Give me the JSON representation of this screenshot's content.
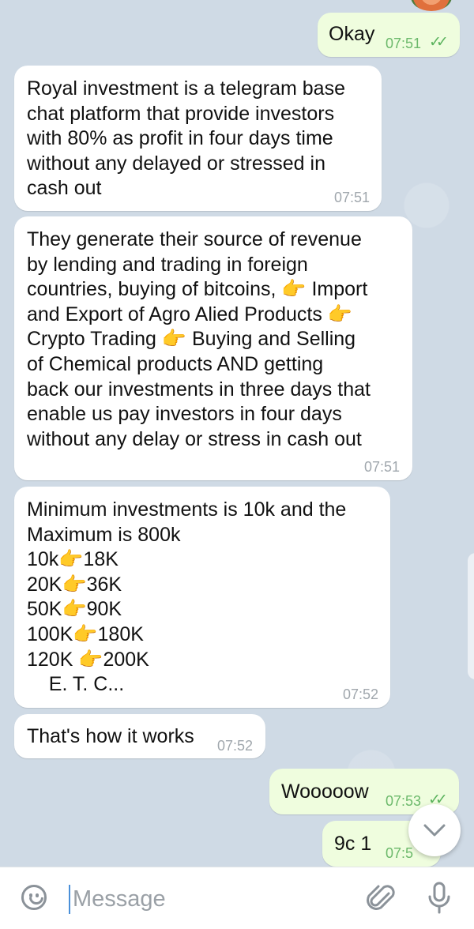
{
  "messages": [
    {
      "dir": "out",
      "lines": [
        "Okay"
      ],
      "time": "07:51",
      "read": "✓✓"
    },
    {
      "dir": "in",
      "lines": [
        "Royal investment is a telegram base",
        "chat platform that provide investors",
        "with 80% as profit in four days time",
        "without any delayed or stressed in",
        "cash out"
      ],
      "time": "07:51"
    },
    {
      "dir": "in",
      "lines": [
        "They generate their source of revenue",
        "by lending and trading in foreign",
        "countries, buying of bitcoins, 👉 Import",
        "and Export of Agro Alied Products 👉",
        "Crypto Trading 👉 Buying and Selling",
        "of Chemical products AND getting",
        "back our investments in three days that",
        "enable us pay investors in four days",
        "without any delay or stress in cash out"
      ],
      "time": "07:51"
    },
    {
      "dir": "in",
      "lines": [
        "Minimum investments is 10k and the",
        "Maximum is 800k",
        "10k👉18K",
        "20K👉36K",
        "50K👉90K",
        "100K👉180K",
        "120K 👉200K",
        "    E. T. C..."
      ],
      "time": "07:52"
    },
    {
      "dir": "in",
      "lines": [
        "That's how it works"
      ],
      "time": "07:52"
    },
    {
      "dir": "out",
      "lines": [
        "Wooooow"
      ],
      "time": "07:53",
      "read": "✓✓"
    },
    {
      "dir": "out",
      "lines": [
        "9c 1"
      ],
      "time": "07:5"
    }
  ],
  "input": {
    "placeholder": "Message"
  },
  "icons": {
    "emoji": "smiley-icon",
    "attach": "paperclip-icon",
    "mic": "microphone-icon",
    "scroll": "chevron-down-icon"
  },
  "scroll_glyph": "⌄",
  "colors": {
    "incoming": "#ffffff",
    "outgoing": "#effdde",
    "read_ticks": "#5bb35d",
    "accent": "#4a90d9"
  }
}
